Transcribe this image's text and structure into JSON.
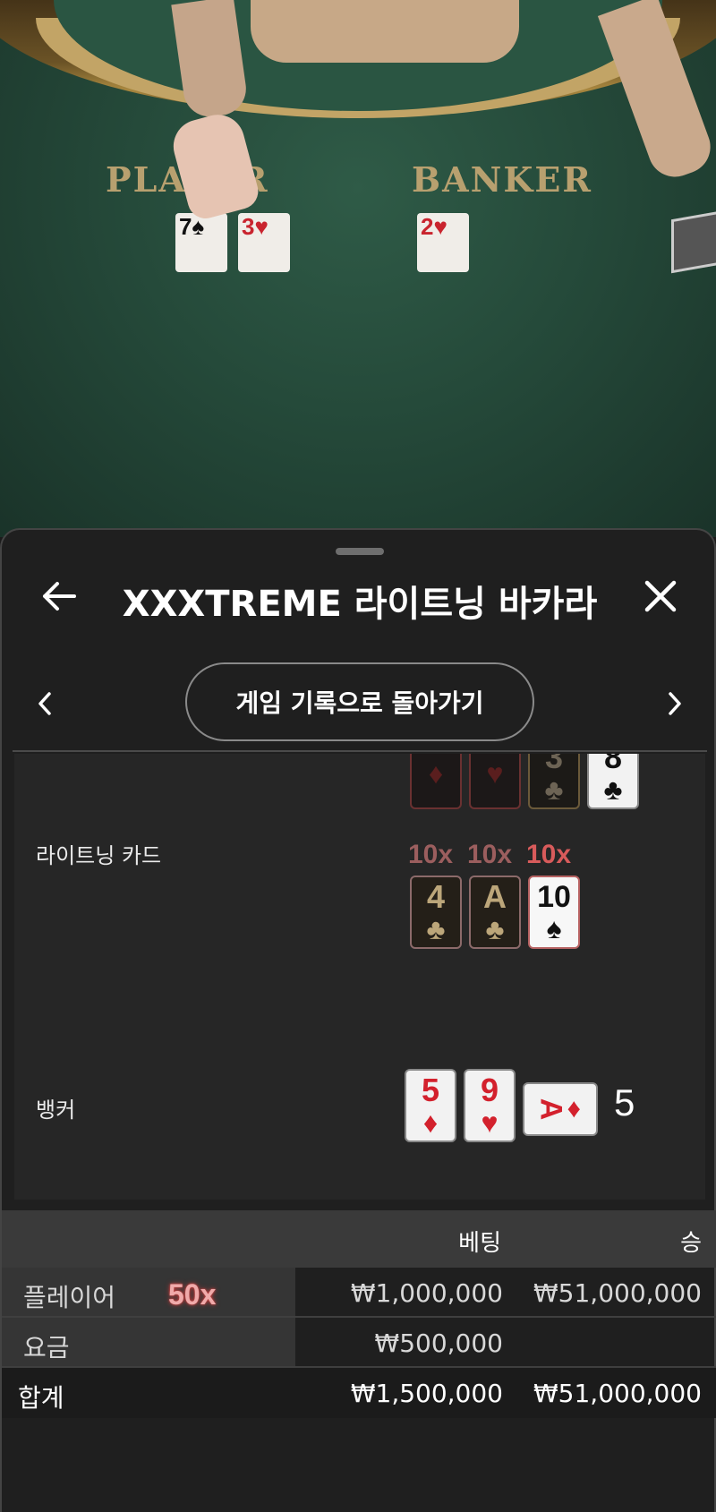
{
  "video": {
    "player_label": "PLAYER",
    "banker_label": "BANKER",
    "player_cards": [
      {
        "rank": "7",
        "suit": "♠",
        "color": "black"
      },
      {
        "rank": "3",
        "suit": "♥",
        "color": "red"
      }
    ],
    "banker_cards": [
      {
        "rank": "2",
        "suit": "♥",
        "color": "red"
      }
    ]
  },
  "header": {
    "title": "XXXTREME 라이트닝 바카라",
    "back_icon": "arrow-left-icon",
    "close_icon": "close-icon"
  },
  "nav": {
    "prev_icon": "chevron-left-icon",
    "next_icon": "chevron-right-icon",
    "return_label": "게임 기록으로 돌아가기"
  },
  "result": {
    "top_partial_cards": [
      {
        "rank": "",
        "suit": "♦",
        "style": "dimred"
      },
      {
        "rank": "",
        "suit": "♥",
        "style": "dimred"
      },
      {
        "rank": "3",
        "suit": "♣",
        "style": "dim"
      },
      {
        "rank": "8",
        "suit": "♣",
        "style": "white-black"
      }
    ],
    "lightning_label": "라이트닝 카드",
    "lightning_cards": [
      {
        "multiplier": "10x",
        "rank": "4",
        "suit": "♣",
        "style": "gold",
        "hot": false
      },
      {
        "multiplier": "10x",
        "rank": "A",
        "suit": "♣",
        "style": "gold",
        "hot": false
      },
      {
        "multiplier": "10x",
        "rank": "10",
        "suit": "♠",
        "style": "white",
        "hot": true
      }
    ],
    "banker_label": "뱅커",
    "banker_cards": [
      {
        "rank": "5",
        "suit": "♦",
        "color": "red"
      },
      {
        "rank": "9",
        "suit": "♥",
        "color": "red"
      },
      {
        "rank": "A",
        "suit": "♦",
        "color": "red",
        "sideways": true
      }
    ],
    "banker_total": "5"
  },
  "bets": {
    "header": {
      "bet": "베팅",
      "win": "승"
    },
    "rows": [
      {
        "name": "플레이어",
        "multiplier": "50x",
        "bet": "₩1,000,000",
        "win": "₩51,000,000"
      },
      {
        "name": "요금",
        "bet": "₩500,000",
        "win": ""
      }
    ],
    "total": {
      "name": "합계",
      "bet": "₩1,500,000",
      "win": "₩51,000,000"
    }
  }
}
